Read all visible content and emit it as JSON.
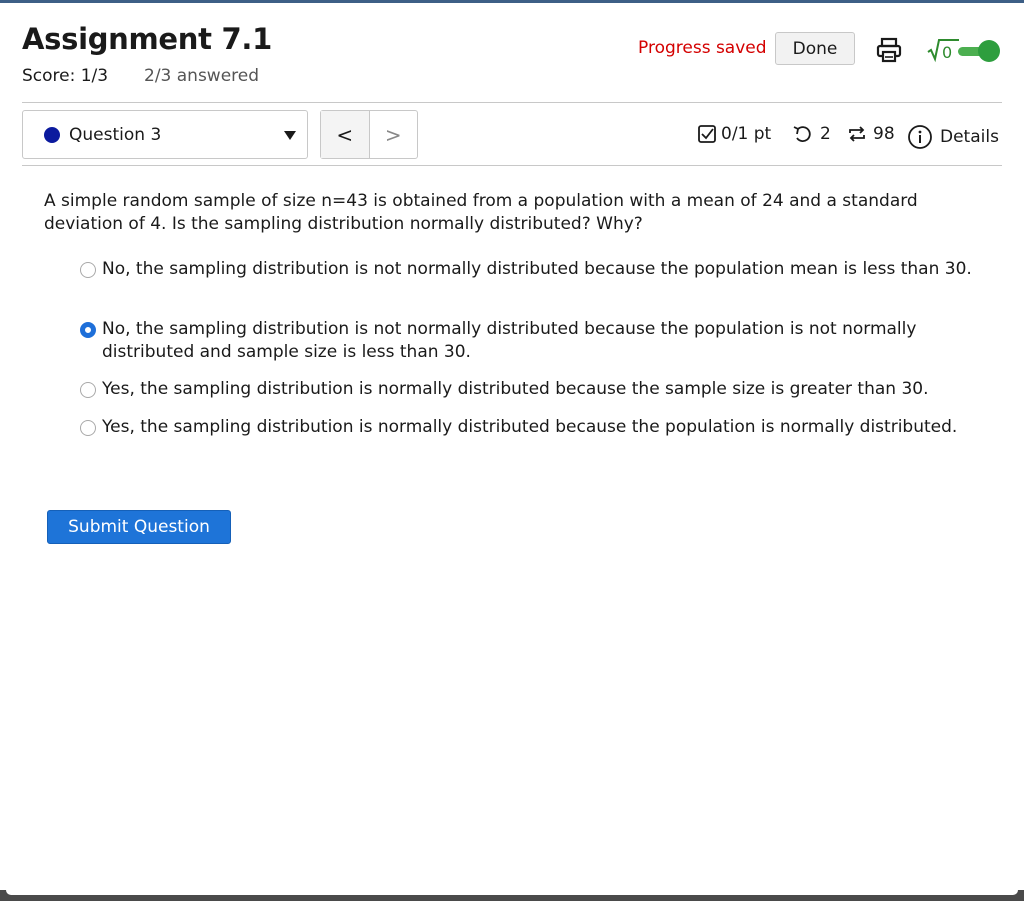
{
  "header": {
    "title": "Assignment 7.1",
    "score": "Score: 1/3",
    "answered": "2/3 answered",
    "progress_saved": "Progress saved",
    "done_label": "Done",
    "sqrt_label": "√0",
    "toggle_on": true
  },
  "question_nav": {
    "selected_question": "Question 3",
    "prev_label": "<",
    "next_label": ">"
  },
  "meta": {
    "points": "0/1 pt",
    "retries": "2",
    "attempts": "98",
    "details_label": "Details"
  },
  "question": {
    "text": "A simple random sample of size n=43 is obtained from a population with a mean of 24 and a standard deviation of 4. Is the sampling distribution normally distributed? Why?",
    "options": [
      {
        "label": "No, the sampling distribution is not normally distributed because the population mean is less than 30.",
        "selected": false
      },
      {
        "label": "No, the sampling distribution is not normally distributed because the population is not normally distributed and sample size is less than 30.",
        "selected": true
      },
      {
        "label": "Yes, the sampling distribution is normally distributed because the sample size is greater than 30.",
        "selected": false
      },
      {
        "label": "Yes, the sampling distribution is normally distributed because the population is normally distributed.",
        "selected": false
      }
    ]
  },
  "submit_label": "Submit Question",
  "colors": {
    "accent": "#1e74d8",
    "progress_saved": "#d40000",
    "toggle_on": "#2e9e3e",
    "question_dot": "#0b1a9e"
  }
}
